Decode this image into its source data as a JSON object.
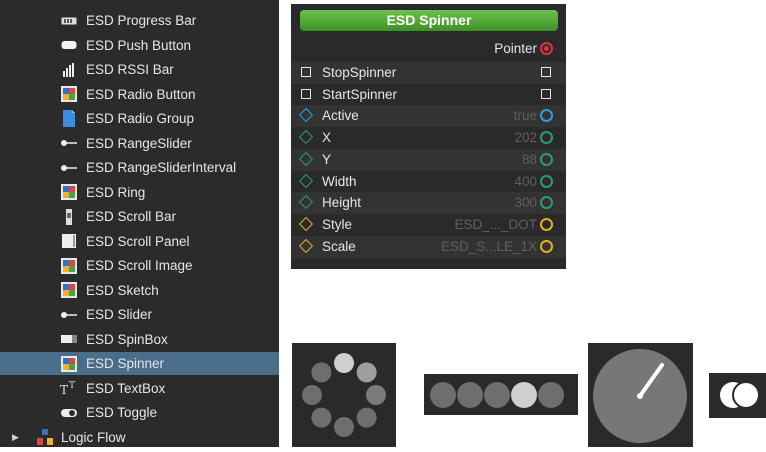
{
  "tree": {
    "items": [
      {
        "label": "ESD Progress Bar",
        "icon": "progress-bar-icon"
      },
      {
        "label": "ESD Push Button",
        "icon": "push-button-icon"
      },
      {
        "label": "ESD RSSI Bar",
        "icon": "rssi-bar-icon"
      },
      {
        "label": "ESD Radio Button",
        "icon": "widget-icon"
      },
      {
        "label": "ESD Radio Group",
        "icon": "document-icon"
      },
      {
        "label": "ESD RangeSlider",
        "icon": "slider-icon"
      },
      {
        "label": "ESD RangeSliderInterval",
        "icon": "slider-icon"
      },
      {
        "label": "ESD Ring",
        "icon": "widget-icon"
      },
      {
        "label": "ESD Scroll Bar",
        "icon": "scrollbar-icon"
      },
      {
        "label": "ESD Scroll Panel",
        "icon": "panel-icon"
      },
      {
        "label": "ESD Scroll Image",
        "icon": "widget-icon"
      },
      {
        "label": "ESD Sketch",
        "icon": "widget-icon"
      },
      {
        "label": "ESD Slider",
        "icon": "slider-icon"
      },
      {
        "label": "ESD SpinBox",
        "icon": "spinbox-icon"
      },
      {
        "label": "ESD Spinner",
        "icon": "widget-icon",
        "selected": true
      },
      {
        "label": "ESD TextBox",
        "icon": "textbox-icon"
      },
      {
        "label": "ESD Toggle",
        "icon": "toggle-icon"
      }
    ],
    "category": {
      "label": "Logic Flow",
      "icon": "logic-flow-icon"
    }
  },
  "node": {
    "title": "ESD Spinner",
    "pointer_label": "Pointer",
    "props": [
      {
        "label": "StopSpinner",
        "value": "",
        "kind": "trigger"
      },
      {
        "label": "StartSpinner",
        "value": "",
        "kind": "trigger"
      },
      {
        "label": "Active",
        "value": "true",
        "kind": "bool"
      },
      {
        "label": "X",
        "value": "202",
        "kind": "int"
      },
      {
        "label": "Y",
        "value": "88",
        "kind": "int"
      },
      {
        "label": "Width",
        "value": "400",
        "kind": "int"
      },
      {
        "label": "Height",
        "value": "300",
        "kind": "int"
      },
      {
        "label": "Style",
        "value": "ESD_..._DOT",
        "kind": "enum"
      },
      {
        "label": "Scale",
        "value": "ESD_S...LE_1X",
        "kind": "enum"
      }
    ]
  },
  "colors": {
    "selected_row": "#4a6d8c",
    "title_green": "#4fae33",
    "pointer_red": "#d9363e",
    "bool_blue": "#2aa1d9",
    "int_green": "#2e9c6a",
    "enum_yellow": "#e0b020"
  }
}
